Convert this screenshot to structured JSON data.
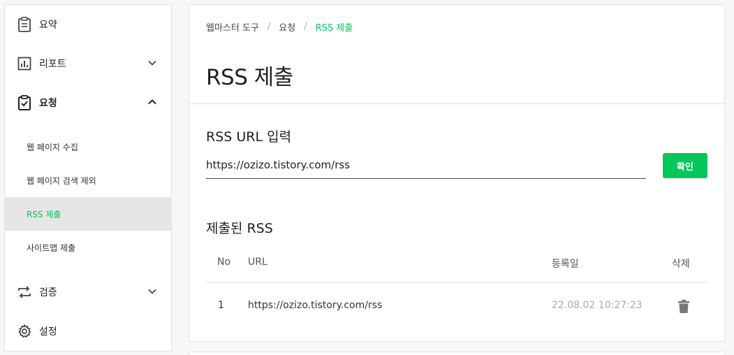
{
  "sidebar": {
    "items": [
      {
        "label": "요약",
        "icon": "clipboard-icon"
      },
      {
        "label": "리포트",
        "icon": "bar-chart-icon",
        "expanded": false
      },
      {
        "label": "요청",
        "icon": "clipboard-check-icon",
        "expanded": true
      },
      {
        "label": "검증",
        "icon": "repeat-arrows-icon",
        "expanded": false
      },
      {
        "label": "설정",
        "icon": "gear-icon"
      }
    ],
    "sub_items": [
      {
        "label": "웹 페이지 수집",
        "active": false
      },
      {
        "label": "웹 페이지 검색 제외",
        "active": false
      },
      {
        "label": "RSS 제출",
        "active": true
      },
      {
        "label": "사이트맵 제출",
        "active": false
      }
    ]
  },
  "breadcrumb": [
    "웹마스터 도구",
    "요청",
    "RSS 제출"
  ],
  "page_title": "RSS 제출",
  "rss_input": {
    "label": "RSS URL 입력",
    "value": "https://ozizo.tistory.com/rss",
    "button_label": "확인"
  },
  "submitted": {
    "title": "제출된 RSS",
    "columns": [
      "No",
      "URL",
      "등록일",
      "삭제"
    ],
    "rows": [
      {
        "no": "1",
        "url": "https://ozizo.tistory.com/rss",
        "date": "22.08.02 10:27:23",
        "delete_icon": "trash-icon"
      }
    ]
  },
  "colors": {
    "accent": "#03c75a",
    "active_bg": "#e6e6e6"
  }
}
